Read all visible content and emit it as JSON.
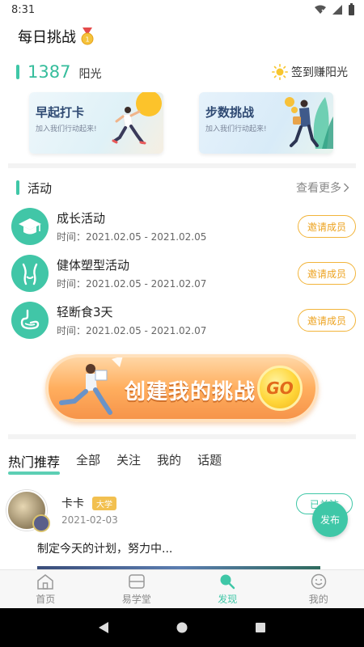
{
  "status_bar": {
    "time": "8:31"
  },
  "header": {
    "title": "每日挑战"
  },
  "sunshine": {
    "count": "1387",
    "unit": "阳光",
    "checkin_label": "签到赚阳光"
  },
  "banners": [
    {
      "title": "早起打卡",
      "subtitle": "加入我们行动起来!"
    },
    {
      "title": "步数挑战",
      "subtitle": "加入我们行动起来!"
    }
  ],
  "activities": {
    "section_title": "活动",
    "more_label": "查看更多",
    "items": [
      {
        "name": "成长活动",
        "time": "时间：2021.02.05 - 2021.02.05",
        "action": "邀请成员",
        "icon": "graduation-cap-icon"
      },
      {
        "name": "健体塑型活动",
        "time": "时间：2021.02.05 - 2021.02.07",
        "action": "邀请成员",
        "icon": "body-shape-icon"
      },
      {
        "name": "轻断食3天",
        "time": "时间：2021.02.05 - 2021.02.07",
        "action": "邀请成员",
        "icon": "stomach-icon"
      }
    ]
  },
  "create_challenge": {
    "label": "创建我的挑战",
    "go": "GO"
  },
  "feed_tabs": [
    {
      "label": "热门推荐",
      "active": true
    },
    {
      "label": "全部"
    },
    {
      "label": "关注"
    },
    {
      "label": "我的"
    },
    {
      "label": "话题"
    }
  ],
  "post": {
    "name": "卡卡",
    "tag": "大学",
    "date": "2021-02-03",
    "follow_label": "已关注",
    "content": "制定今天的计划，努力中..."
  },
  "publish_label": "发布",
  "bottom_nav": [
    {
      "label": "首页",
      "icon": "home-icon"
    },
    {
      "label": "易学堂",
      "icon": "school-icon"
    },
    {
      "label": "发现",
      "icon": "discover-icon",
      "active": true
    },
    {
      "label": "我的",
      "icon": "smiley-icon"
    }
  ],
  "colors": {
    "accent": "#3fc7a7",
    "invite": "#eda320",
    "create_btn": "#f6944a"
  }
}
